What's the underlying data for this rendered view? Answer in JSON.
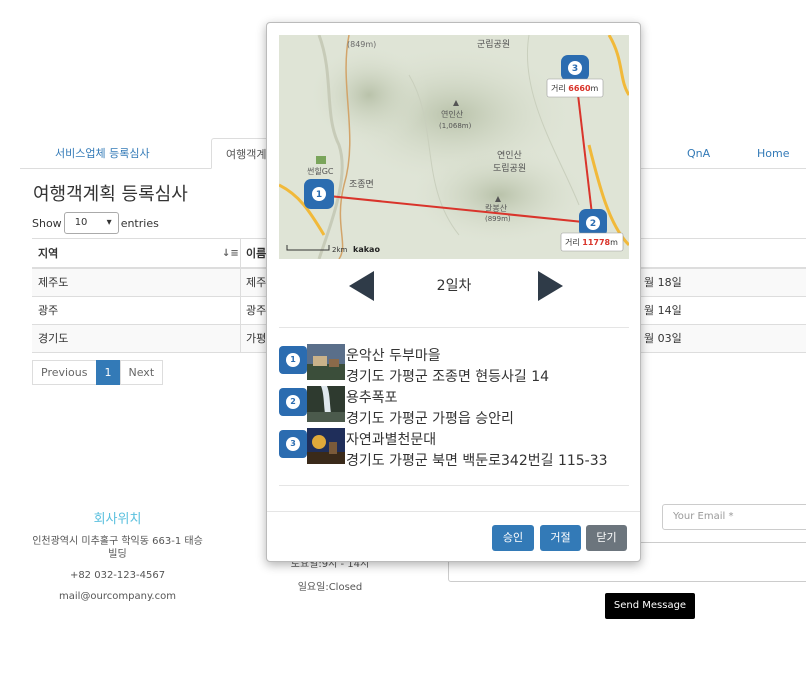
{
  "tabs": {
    "service": "서비스업체 등록심사",
    "travel": "여행객계",
    "qna": "QnA",
    "home": "Home"
  },
  "page_title": "여행객계획 등록심사",
  "table_controls": {
    "show": "Show",
    "entries_value": "10",
    "entries": "entries"
  },
  "table": {
    "headers": [
      "지역",
      "이름"
    ],
    "rows": [
      {
        "region": "제주도",
        "name": "제주",
        "date": "월 18일"
      },
      {
        "region": "광주",
        "name": "광주",
        "date": "월 14일"
      },
      {
        "region": "경기도",
        "name": "가평",
        "date": "월 03일"
      }
    ]
  },
  "pagination": {
    "previous": "Previous",
    "current": "1",
    "next": "Next"
  },
  "footer": {
    "location_title": "회사위치",
    "address": "인천광역시 미추홀구 학익동 663-1 태승빌딩",
    "phone": "+82 032-123-4567",
    "email": "mail@ourcompany.com",
    "hours_partial": "토요일:9시 - 14시",
    "sunday": "일요일:Closed",
    "email_placeholder": "Your Email *",
    "send_label": "Send Message"
  },
  "modal": {
    "map": {
      "labels": {
        "peak1": "(849m)",
        "park_top": "군립공원",
        "yeonin_peak": "연인산",
        "yeonin_height": "(1,068m)",
        "yeonin_park1": "연인산",
        "yeonin_park2": "도립공원",
        "golf": "썬힐GC",
        "jojong": "조종면",
        "kalbong": "칼봉산",
        "kalbong_height": "(899m)",
        "scale": "2km",
        "brand": "kakao"
      },
      "markers": [
        "1",
        "2",
        "3"
      ],
      "distances": [
        {
          "prefix": "거리 ",
          "value": "6660",
          "unit": "m"
        },
        {
          "prefix": "거리 ",
          "value": "11778",
          "unit": "m"
        }
      ],
      "route_color": "#d9342b"
    },
    "day_label": "2일차",
    "places": [
      {
        "num": "1",
        "name": "운악산 두부마을",
        "address": "경기도 가평군 조종면 현등사길 14"
      },
      {
        "num": "2",
        "name": "용추폭포",
        "address": "경기도 가평군 가평읍 승안리"
      },
      {
        "num": "3",
        "name": "자연과별천문대",
        "address": "경기도 가평군 북면 백둔로342번길 115-33"
      }
    ],
    "buttons": {
      "approve": "승인",
      "reject": "거절",
      "close": "닫기"
    }
  }
}
